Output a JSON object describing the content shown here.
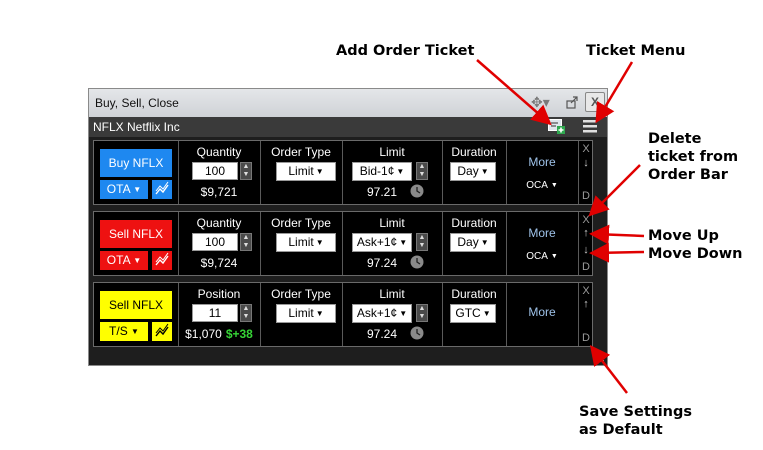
{
  "annotations": {
    "add_order_ticket": "Add Order Ticket",
    "ticket_menu": "Ticket Menu",
    "delete_ticket_line1": "Delete",
    "delete_ticket_line2": "ticket from",
    "delete_ticket_line3": "Order Bar",
    "move_up": "Move Up",
    "move_down": "Move Down",
    "save_settings_line1": "Save Settings",
    "save_settings_line2": "as Default"
  },
  "window": {
    "title": "Buy, Sell, Close",
    "close_label": "X",
    "symbol": "NFLX Netflix Inc"
  },
  "headers": {
    "quantity": "Quantity",
    "position": "Position",
    "order_type": "Order Type",
    "limit": "Limit",
    "duration": "Duration"
  },
  "tickets": [
    {
      "action": "Buy NFLX",
      "action_color": "#1e88f0",
      "action_text_color": "#ffffff",
      "sub": "OTA",
      "sub_color": "#1e88f0",
      "qty_header": "Quantity",
      "qty": "100",
      "qty_value": "$9,721",
      "pnl": "",
      "order_type": "Limit",
      "limit": "Bid-1¢",
      "limit_price": "97.21",
      "duration": "Day",
      "more": "More",
      "oca": "OCA",
      "side": [
        "X",
        "↓",
        "D"
      ]
    },
    {
      "action": "Sell NFLX",
      "action_color": "#ee1111",
      "action_text_color": "#ffffff",
      "sub": "OTA",
      "sub_color": "#ee1111",
      "qty_header": "Quantity",
      "qty": "100",
      "qty_value": "$9,724",
      "pnl": "",
      "order_type": "Limit",
      "limit": "Ask+1¢",
      "limit_price": "97.24",
      "duration": "Day",
      "more": "More",
      "oca": "OCA",
      "side": [
        "X",
        "↑",
        "↓",
        "D"
      ]
    },
    {
      "action": "Sell NFLX",
      "action_color": "#ffff00",
      "action_text_color": "#000000",
      "sub": "T/S",
      "sub_color": "#ffff00",
      "qty_header": "Position",
      "qty": "11",
      "qty_value": "$1,070",
      "pnl": "$+38",
      "order_type": "Limit",
      "limit": "Ask+1¢",
      "limit_price": "97.24",
      "duration": "GTC",
      "more": "More",
      "oca": "",
      "side": [
        "X",
        "↑",
        "D"
      ]
    }
  ]
}
